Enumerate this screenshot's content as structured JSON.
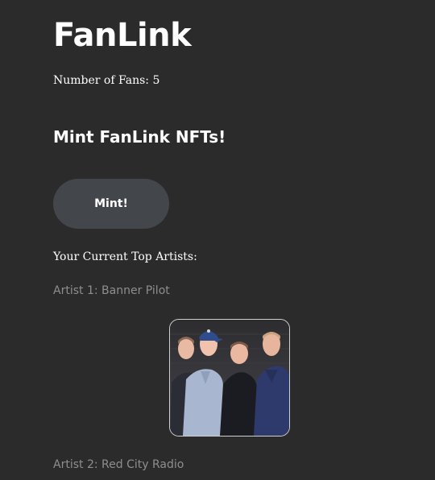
{
  "app": {
    "title": "FanLink"
  },
  "fans": {
    "label": "Number of Fans:",
    "count": "5"
  },
  "mint": {
    "heading": "Mint FanLink NFTs!",
    "button_label": "Mint!"
  },
  "top_artists": {
    "heading": "Your Current Top Artists:",
    "items": [
      {
        "prefix": "Artist 1:",
        "name": "Banner Pilot",
        "has_photo": true
      },
      {
        "prefix": "Artist 2:",
        "name": "Red City Radio",
        "has_photo": false
      }
    ]
  },
  "colors": {
    "background": "#2b2b2b",
    "button_bg": "#43464b",
    "muted_text": "#8e8e8e"
  }
}
